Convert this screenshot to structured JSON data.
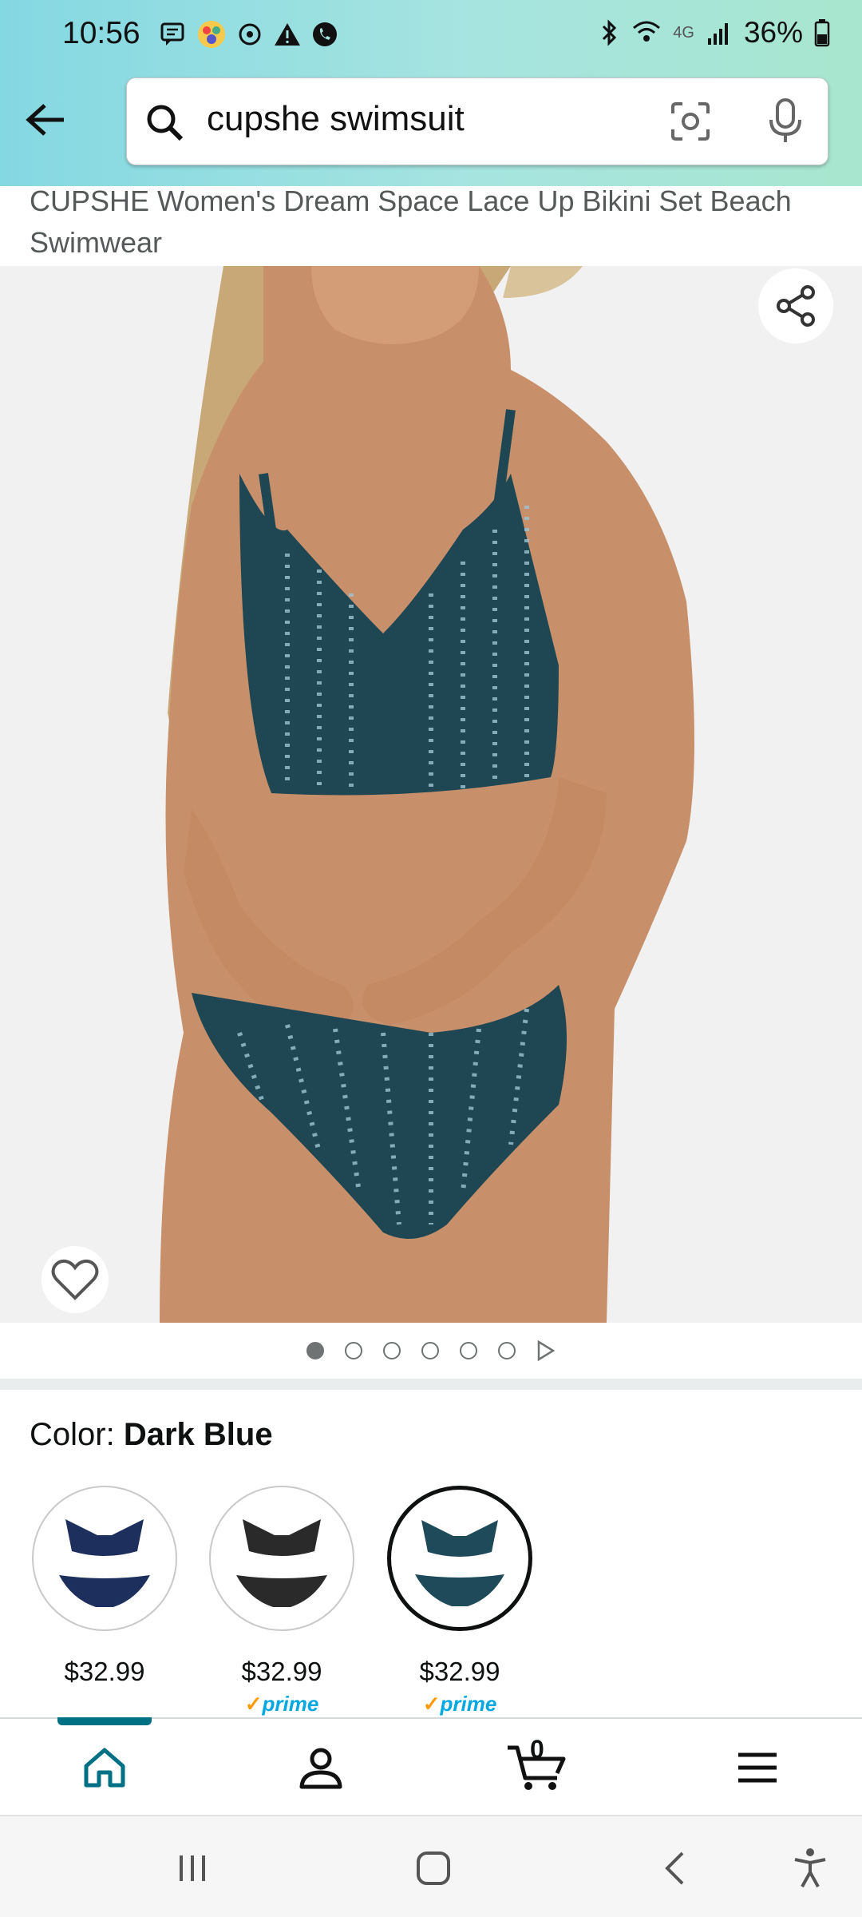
{
  "status_bar": {
    "time": "10:56",
    "network": "4G",
    "battery": "36%"
  },
  "search": {
    "query": "cupshe swimsuit",
    "icons": [
      "back-arrow-icon",
      "search-icon",
      "camera-icon",
      "mic-icon"
    ]
  },
  "product": {
    "title": "CUPSHE Women's Dream Space Lace Up Bikini Set Beach Swimwear",
    "image_icons": [
      "share-icon",
      "heart-icon"
    ],
    "carousel": {
      "total_dots": 6,
      "active_index": 0,
      "has_play": true
    }
  },
  "color_section": {
    "label": "Color:",
    "selected": "Dark Blue",
    "options": [
      {
        "price": "$32.99",
        "prime": false,
        "swatch_color": "#1d2f5c"
      },
      {
        "price": "$32.99",
        "prime": true,
        "prime_label": "prime",
        "swatch_color": "#2a2a2a"
      },
      {
        "price": "$32.99",
        "prime": true,
        "prime_label": "prime",
        "swatch_color": "#1f4a5a",
        "selected": true
      }
    ]
  },
  "bottom_nav": {
    "items": [
      "home-icon",
      "account-icon",
      "cart-icon",
      "menu-icon"
    ],
    "cart_count": "0",
    "active": "home"
  },
  "colors": {
    "accent": "#007185",
    "prime_blue": "#00a8e1",
    "prime_check": "#ff9900"
  }
}
